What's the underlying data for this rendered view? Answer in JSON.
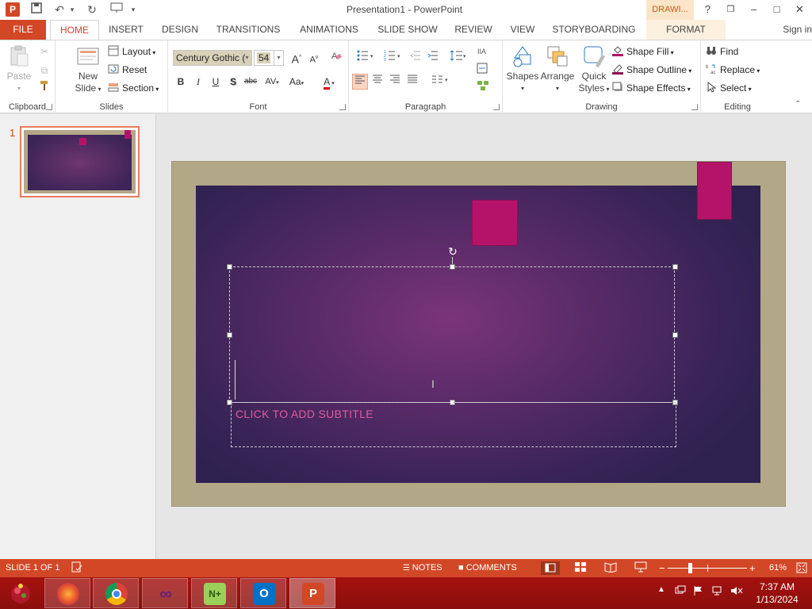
{
  "titlebar": {
    "app_icon": "P",
    "title": "Presentation1 - PowerPoint",
    "context_tab": "DRAWI...",
    "help": "?",
    "restore": "❒",
    "minimize": "–",
    "maximize": "□",
    "close": "✕"
  },
  "tabs": {
    "file": "FILE",
    "home": "HOME",
    "insert": "INSERT",
    "design": "DESIGN",
    "transitions": "TRANSITIONS",
    "animations": "ANIMATIONS",
    "slide_show": "SLIDE SHOW",
    "review": "REVIEW",
    "view": "VIEW",
    "storyboarding": "STORYBOARDING",
    "format": "FORMAT",
    "sign_in": "Sign in"
  },
  "ribbon": {
    "clipboard": {
      "label": "Clipboard",
      "paste": "Paste"
    },
    "slides": {
      "label": "Slides",
      "new_slide_1": "New",
      "new_slide_2": "Slide",
      "layout": "Layout",
      "reset": "Reset",
      "section": "Section"
    },
    "font": {
      "label": "Font",
      "font_name": "Century Gothic (",
      "font_size": "54",
      "bold": "B",
      "italic": "I",
      "underline": "U",
      "shadow": "S",
      "strike": "abc",
      "spacing": "AV",
      "case": "Aa",
      "color": "A"
    },
    "paragraph": {
      "label": "Paragraph"
    },
    "drawing": {
      "label": "Drawing",
      "shapes": "Shapes",
      "arrange": "Arrange",
      "quick_styles_1": "Quick",
      "quick_styles_2": "Styles",
      "shape_fill": "Shape Fill",
      "shape_outline": "Shape Outline",
      "shape_effects": "Shape Effects"
    },
    "editing": {
      "label": "Editing",
      "find": "Find",
      "replace": "Replace",
      "select": "Select"
    }
  },
  "thumbnails": {
    "slide_number": "1"
  },
  "slide": {
    "subtitle_placeholder": "CLICK TO ADD SUBTITLE"
  },
  "statusbar": {
    "slide_info": "SLIDE 1 OF 1",
    "notes": "NOTES",
    "comments": "COMMENTS",
    "zoom_minus": "−",
    "zoom_plus": "+",
    "zoom_percent": "61%",
    "zoom_level": 0.61
  },
  "taskbar": {
    "clock_time": "7:37 AM",
    "clock_date": "1/13/2024"
  },
  "colors": {
    "accent": "#d24726",
    "slide_frame": "#b2a888",
    "slide_square": "#b5136a",
    "subtitle_text": "#e05aa0"
  }
}
